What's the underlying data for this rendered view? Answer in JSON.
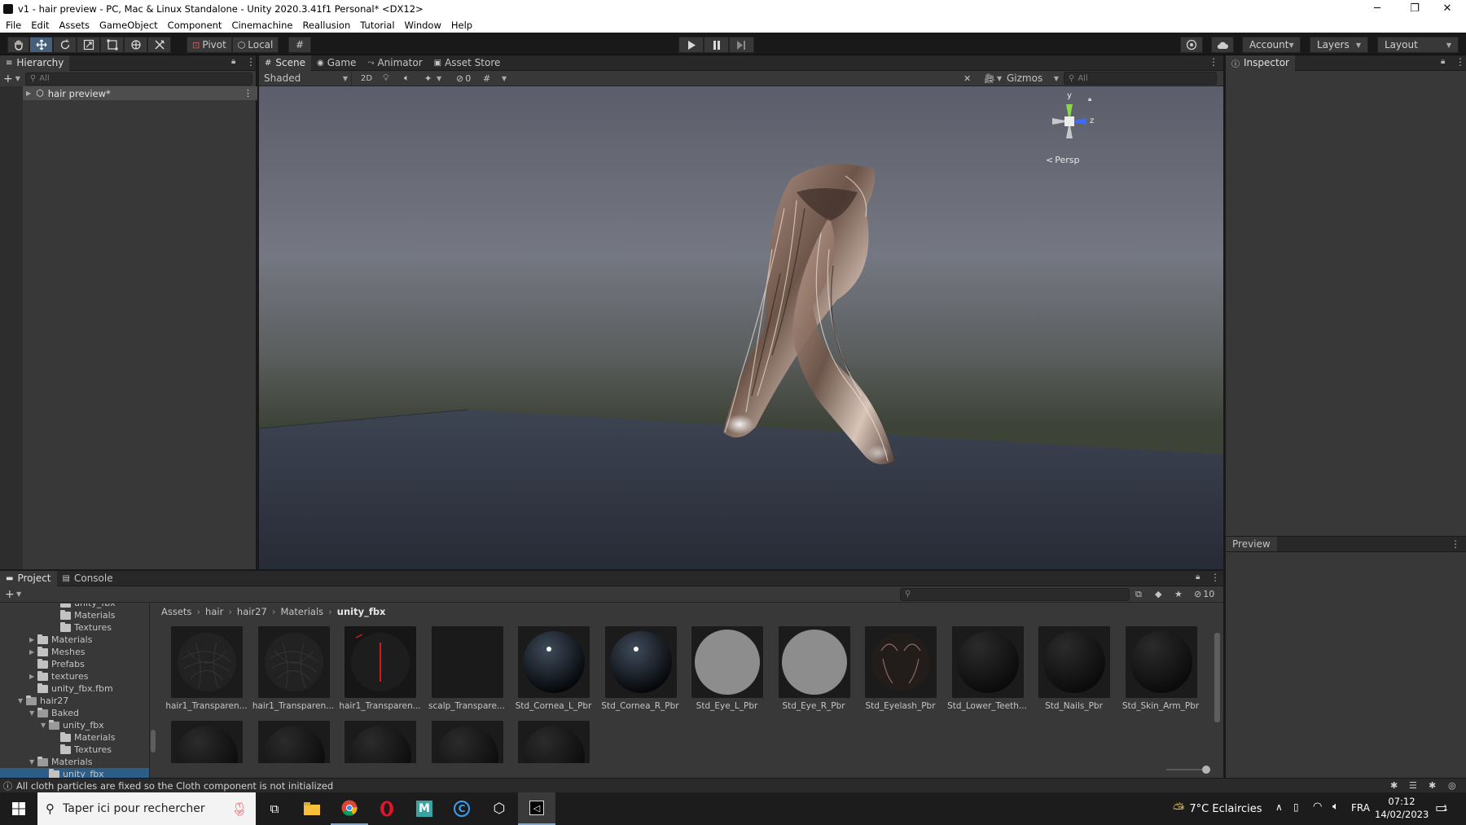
{
  "window": {
    "title": "v1 - hair preview - PC, Mac & Linux Standalone - Unity 2020.3.41f1 Personal* <DX12>",
    "minimize": "─",
    "restore": "❐",
    "close": "✕"
  },
  "menu": [
    "File",
    "Edit",
    "Assets",
    "GameObject",
    "Component",
    "Cinemachine",
    "Reallusion",
    "Tutorial",
    "Window",
    "Help"
  ],
  "toolbar": {
    "pivot_label": "Pivot",
    "local_label": "Local",
    "account_label": "Account",
    "layers_label": "Layers",
    "layout_label": "Layout"
  },
  "hierarchy": {
    "tab_label": "Hierarchy",
    "search_placeholder": "All",
    "root_item": "hair preview*"
  },
  "scene": {
    "tabs": [
      "Scene",
      "Game",
      "Animator",
      "Asset Store"
    ],
    "shading_mode": "Shaded",
    "mode_2d": "2D",
    "hidden_count": "0",
    "gizmos_label": "Gizmos",
    "search_placeholder": "All",
    "persp_label": "Persp",
    "axis_y": "y",
    "axis_z": "z"
  },
  "inspector": {
    "tab_label": "Inspector",
    "preview_label": "Preview"
  },
  "project": {
    "tabs": [
      "Project",
      "Console"
    ],
    "visible_count": "10",
    "breadcrumb": [
      "Assets",
      "hair",
      "hair27",
      "Materials",
      "unity_fbx"
    ],
    "tree": [
      {
        "label": "unity_fbx",
        "depth": 4,
        "arrow": "",
        "open": false
      },
      {
        "label": "Materials",
        "depth": 4,
        "arrow": "",
        "open": false
      },
      {
        "label": "Textures",
        "depth": 4,
        "arrow": "",
        "open": false
      },
      {
        "label": "Materials",
        "depth": 2,
        "arrow": "▶",
        "open": false
      },
      {
        "label": "Meshes",
        "depth": 2,
        "arrow": "▶",
        "open": false
      },
      {
        "label": "Prefabs",
        "depth": 2,
        "arrow": "",
        "open": false
      },
      {
        "label": "textures",
        "depth": 2,
        "arrow": "▶",
        "open": false
      },
      {
        "label": "unity_fbx.fbm",
        "depth": 2,
        "arrow": "",
        "open": false
      },
      {
        "label": "hair27",
        "depth": 1,
        "arrow": "▼",
        "open": true
      },
      {
        "label": "Baked",
        "depth": 2,
        "arrow": "▼",
        "open": true
      },
      {
        "label": "unity_fbx",
        "depth": 3,
        "arrow": "▼",
        "open": true
      },
      {
        "label": "Materials",
        "depth": 4,
        "arrow": "",
        "open": false
      },
      {
        "label": "Textures",
        "depth": 4,
        "arrow": "",
        "open": false
      },
      {
        "label": "Materials",
        "depth": 2,
        "arrow": "▼",
        "open": true
      },
      {
        "label": "unity_fbx",
        "depth": 3,
        "arrow": "",
        "open": false
      }
    ],
    "assets": [
      {
        "label": "hair1_Transparen...",
        "kind": "hairball"
      },
      {
        "label": "hair1_Transparen...",
        "kind": "hairball"
      },
      {
        "label": "hair1_Transparen...",
        "kind": "redline"
      },
      {
        "label": "scalp_Transpare...",
        "kind": "dark"
      },
      {
        "label": "Std_Cornea_L_Pbr",
        "kind": "glass"
      },
      {
        "label": "Std_Cornea_R_Pbr",
        "kind": "glass"
      },
      {
        "label": "Std_Eye_L_Pbr",
        "kind": "grey"
      },
      {
        "label": "Std_Eye_R_Pbr",
        "kind": "grey"
      },
      {
        "label": "Std_Eyelash_Pbr",
        "kind": "lash"
      },
      {
        "label": "Std_Lower_Teeth...",
        "kind": "black"
      },
      {
        "label": "Std_Nails_Pbr",
        "kind": "black"
      },
      {
        "label": "Std_Skin_Arm_Pbr",
        "kind": "black"
      },
      {
        "label": "",
        "kind": "black"
      },
      {
        "label": "",
        "kind": "black"
      },
      {
        "label": "",
        "kind": "black"
      },
      {
        "label": "",
        "kind": "black"
      },
      {
        "label": "",
        "kind": "black"
      }
    ]
  },
  "status": {
    "message": "All cloth particles are fixed so the Cloth component is not initialized"
  },
  "taskbar": {
    "search_placeholder": "Taper ici pour rechercher",
    "weather": "7°C  Eclaircies",
    "language": "FRA",
    "time": "07:12",
    "date": "14/02/2023",
    "notifications": "1"
  },
  "colors": {
    "accent_blue": "#46607c",
    "panel_bg": "#383838",
    "dark_bg": "#191919"
  }
}
